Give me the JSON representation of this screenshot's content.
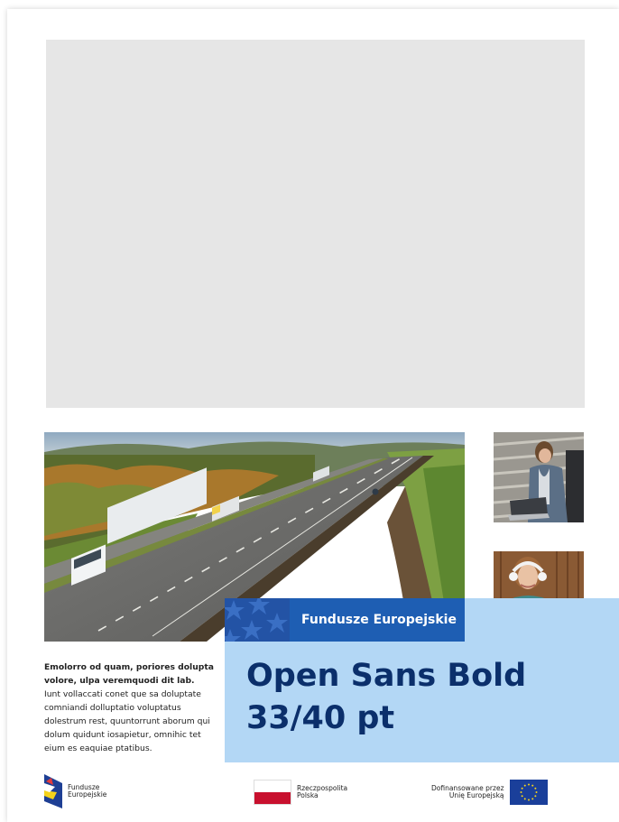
{
  "band": {
    "label": "Fundusze Europejskie"
  },
  "heading": {
    "line1": "Open Sans Bold",
    "line2": "33/40 pt"
  },
  "body": {
    "lead": "Emolorro od quam, poriores dolupta volore, ulpa veremquodi dit lab.",
    "rest": "Iunt vollaccati conet que sa doluptate comniandi dolluptatio voluptatus dolestrum rest, quuntorrunt aborum qui dolum quidunt iosapietur, omnihic tet eium es eaquiae ptatibus."
  },
  "footer": {
    "fe": {
      "line1": "Fundusze",
      "line2": "Europejskie"
    },
    "rp": {
      "line1": "Rzeczpospolita",
      "line2": "Polska"
    },
    "eu": {
      "line1": "Dofinansowane przez",
      "line2": "Unię Europejską"
    }
  },
  "colors": {
    "dark_blue": "#1e5eb3",
    "light_blue": "#b3d7f5",
    "heading_navy": "#0b2f6b",
    "placeholder_gray": "#e6e6e6"
  },
  "images": {
    "hero": "highway-trucks-photo",
    "thumb1": "woman-laptop-stadium-photo",
    "thumb2": "woman-headphones-phone-photo"
  }
}
